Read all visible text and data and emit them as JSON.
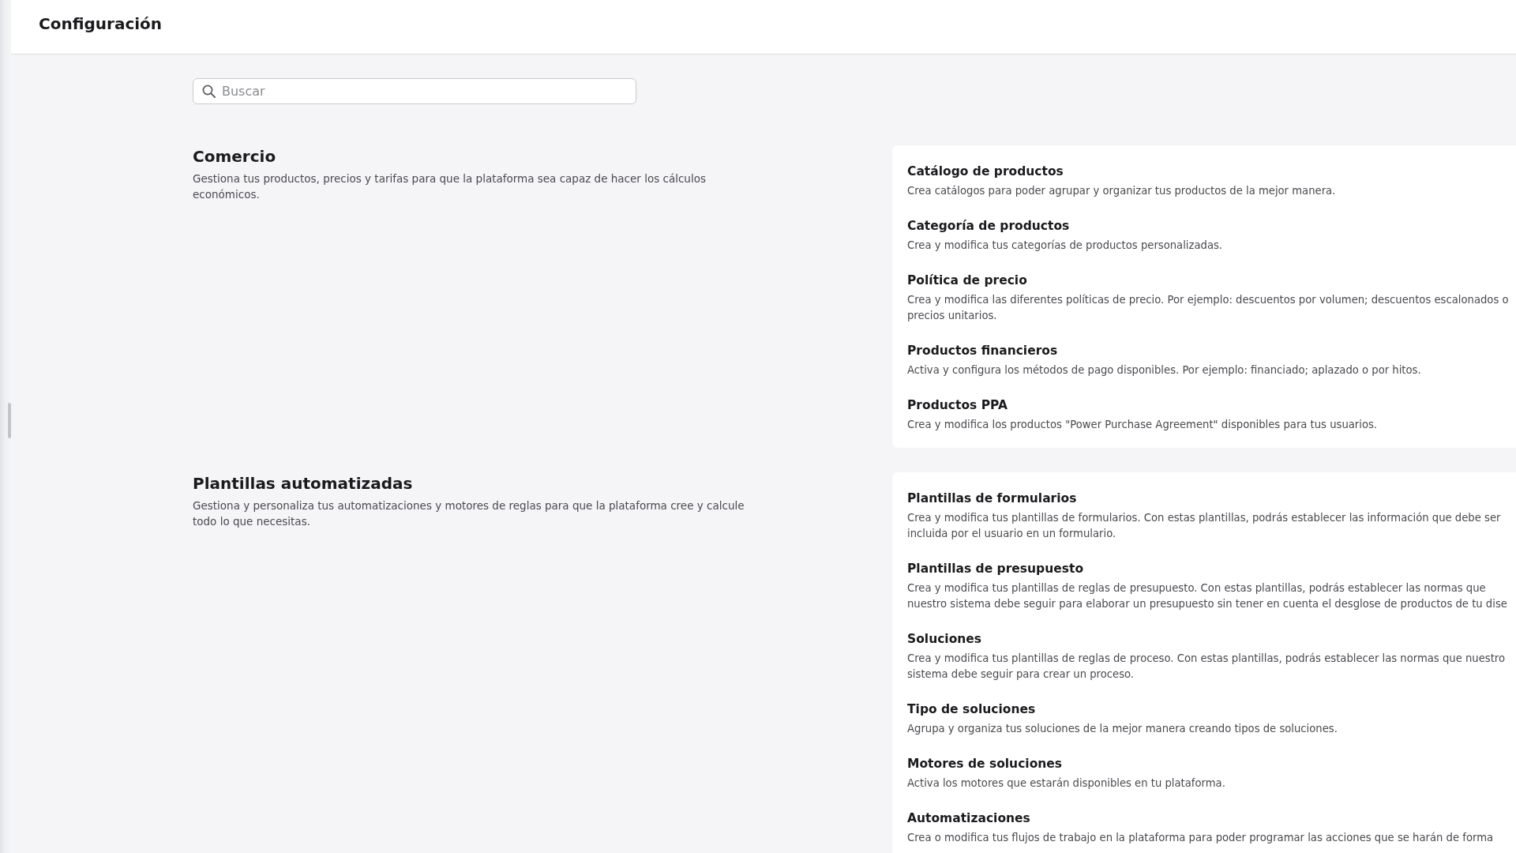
{
  "header": {
    "title": "Configuración"
  },
  "search": {
    "placeholder": "Buscar"
  },
  "sections": [
    {
      "title": "Comercio",
      "description": "Gestiona tus productos, precios y tarifas para que la plataforma sea capaz de hacer los cálculos económicos.",
      "items": [
        {
          "title": "Catálogo de productos",
          "description": "Crea catálogos para poder agrupar y organizar tus productos de la mejor manera."
        },
        {
          "title": "Categoría de productos",
          "description": "Crea y modifica tus categorías de productos personalizadas."
        },
        {
          "title": "Política de precio",
          "description": "Crea y modifica las diferentes políticas de precio. Por ejemplo: descuentos por volumen; descuentos escalonados o precios unitarios."
        },
        {
          "title": "Productos financieros",
          "description": "Activa y configura los métodos de pago disponibles. Por ejemplo: financiado; aplazado o por hitos."
        },
        {
          "title": "Productos PPA",
          "description": "Crea y modifica los productos \"Power Purchase Agreement\" disponibles para tus usuarios."
        }
      ]
    },
    {
      "title": "Plantillas automatizadas",
      "description": "Gestiona y personaliza tus automatizaciones y motores de reglas para que la plataforma cree y calcule todo lo que necesitas.",
      "items": [
        {
          "title": "Plantillas de formularios",
          "description": "Crea y modifica tus plantillas de formularios. Con estas plantillas, podrás establecer las información que debe ser incluida por el usuario en un formulario."
        },
        {
          "title": "Plantillas de presupuesto",
          "description": "Crea y modifica tus plantillas de reglas de presupuesto. Con estas plantillas, podrás establecer las normas que nuestro sistema debe seguir para elaborar un presupuesto sin tener en cuenta el desglose de productos de tu dise"
        },
        {
          "title": "Soluciones",
          "description": "Crea y modifica tus plantillas de reglas de proceso. Con estas plantillas, podrás establecer las normas que nuestro sistema debe seguir para crear un proceso."
        },
        {
          "title": "Tipo de soluciones",
          "description": "Agrupa y organiza tus soluciones de la mejor manera creando tipos de soluciones."
        },
        {
          "title": "Motores de soluciones",
          "description": "Activa los motores que estarán disponibles en tu plataforma."
        },
        {
          "title": "Automatizaciones",
          "description": "Crea o modifica tus flujos de trabajo en la plataforma para poder programar las acciones que se harán de forma"
        }
      ]
    }
  ]
}
